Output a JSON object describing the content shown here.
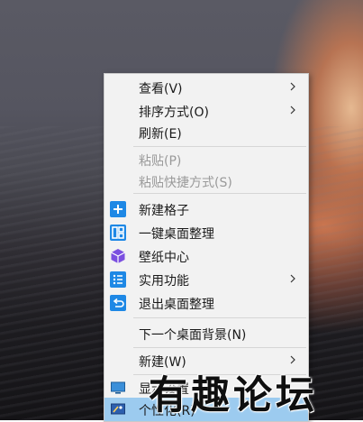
{
  "menu": {
    "items": [
      {
        "label": "查看(V)",
        "submenu": true
      },
      {
        "label": "排序方式(O)",
        "submenu": true
      },
      {
        "label": "刷新(E)"
      },
      {
        "label": "粘贴(P)",
        "disabled": true
      },
      {
        "label": "粘贴快捷方式(S)",
        "disabled": true
      },
      {
        "label": "新建格子",
        "icon": "plus-icon"
      },
      {
        "label": "一键桌面整理",
        "icon": "layout-icon"
      },
      {
        "label": "壁纸中心",
        "icon": "cube-icon"
      },
      {
        "label": "实用功能",
        "icon": "list-icon",
        "submenu": true
      },
      {
        "label": "退出桌面整理",
        "icon": "exit-icon"
      },
      {
        "label": "下一个桌面背景(N)"
      },
      {
        "label": "新建(W)",
        "submenu": true
      },
      {
        "label": "显示设置",
        "icon": "display-icon"
      },
      {
        "label": "个性化(R)",
        "icon": "personalize-icon",
        "highlighted": true
      }
    ]
  },
  "watermark": {
    "text": "有趣论坛"
  },
  "colors": {
    "menu_bg": "#f2f2f2",
    "icon_blue": "#1e88e5",
    "icon_purple": "#7b4fe0",
    "highlight": "#9ccbef"
  }
}
